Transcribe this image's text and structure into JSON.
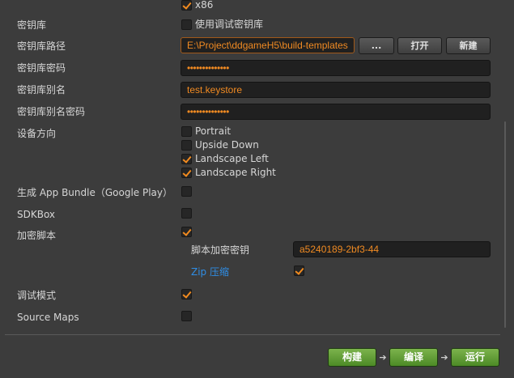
{
  "arch": {
    "x86": {
      "label": "x86",
      "checked": true
    }
  },
  "keystore": {
    "label": "密钥库",
    "use_debug_label": "使用调试密钥库",
    "use_debug_checked": false
  },
  "keystore_path": {
    "label": "密钥库路径",
    "value": "E:\\Project\\ddgameH5\\build-templates",
    "browse_label": "...",
    "open_label": "打开",
    "new_label": "新建"
  },
  "keystore_password": {
    "label": "密钥库密码",
    "value": "••••••••••••••"
  },
  "keystore_alias": {
    "label": "密钥库别名",
    "value": "test.keystore"
  },
  "alias_password": {
    "label": "密钥库别名密码",
    "value": "••••••••••••••"
  },
  "orientation": {
    "label": "设备方向",
    "options": [
      {
        "label": "Portrait",
        "checked": false
      },
      {
        "label": "Upside Down",
        "checked": false
      },
      {
        "label": "Landscape Left",
        "checked": true
      },
      {
        "label": "Landscape Right",
        "checked": true
      }
    ]
  },
  "app_bundle": {
    "label": "生成 App Bundle（Google Play）",
    "checked": false
  },
  "sdkbox": {
    "label": "SDKBox",
    "checked": false
  },
  "encrypt_js": {
    "label": "加密脚本",
    "checked": true
  },
  "encrypt_key": {
    "label": "脚本加密密钥",
    "value": "a5240189-2bf3-44"
  },
  "zip_compress": {
    "label": "Zip 压缩",
    "checked": true
  },
  "debug_mode": {
    "label": "调试模式",
    "checked": true
  },
  "source_maps": {
    "label": "Source Maps",
    "checked": false
  },
  "actions": {
    "build_label": "构建",
    "compile_label": "编译",
    "run_label": "运行"
  },
  "colors": {
    "background": "#3c3c3c",
    "accent_orange": "#f28b1f",
    "link_blue": "#2f8ee6",
    "action_green": "#5f9c36"
  },
  "icons": {
    "check": "checkmark-icon",
    "arrow": "arrow-right-icon"
  }
}
